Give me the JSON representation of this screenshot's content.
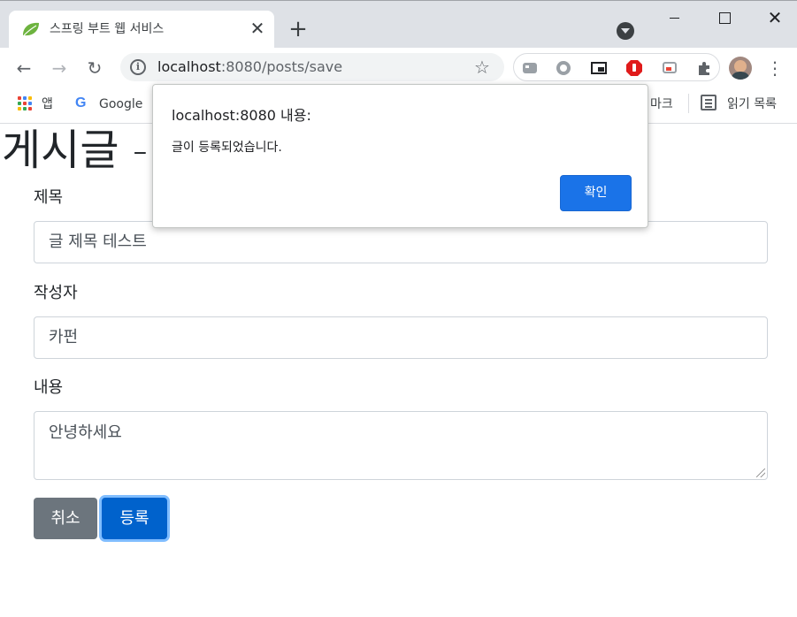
{
  "browser": {
    "tab_title": "스프링 부트 웹 서비스",
    "new_tab_symbol": "+",
    "close_symbol": "✕",
    "url_host": "localhost",
    "url_path": ":8080/posts/save",
    "icons": [
      "leaf-favicon-icon",
      "tab-search-icon",
      "back-icon",
      "forward-icon",
      "reload-icon",
      "info-icon",
      "star-icon",
      "extension-icon",
      "puzzle-icon",
      "kebab-menu-icon"
    ]
  },
  "bookmarks": {
    "apps_label": "앱",
    "google_label": "Google",
    "partial_label": "마크",
    "reading_list_label": "읽기 목록"
  },
  "page": {
    "title": "게시글 -",
    "title_label": "제목",
    "title_value": "글 제목 테스트",
    "author_label": "작성자",
    "author_value": "카펀",
    "content_label": "내용",
    "content_value": "안녕하세요",
    "cancel_label": "취소",
    "save_label": "등록"
  },
  "dialog": {
    "title": "localhost:8080 내용:",
    "message": "글이 등록되었습니다.",
    "ok_label": "확인"
  },
  "colors": {
    "primary": "#0062cc",
    "secondary": "#6c757d",
    "dialog_button": "#1a73e8"
  }
}
